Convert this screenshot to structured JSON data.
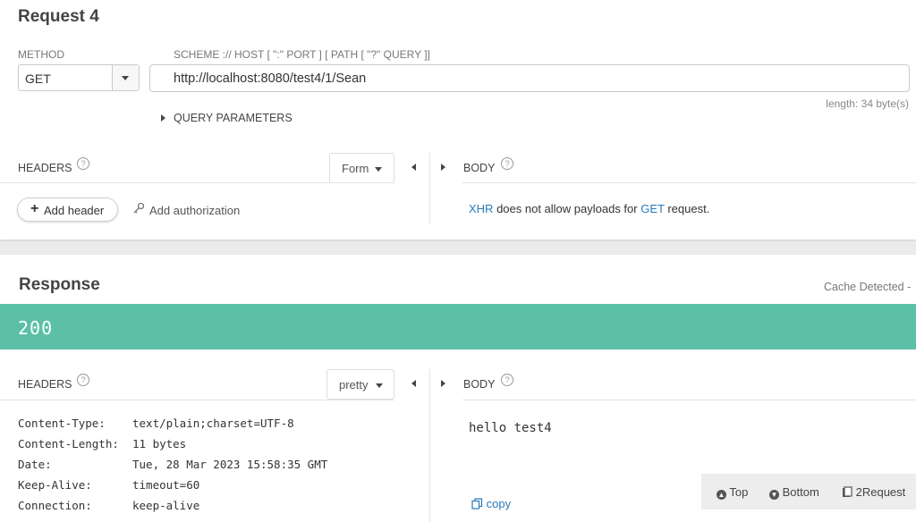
{
  "request": {
    "title": "Request 4",
    "method_label": "METHOD",
    "url_hint": "SCHEME :// HOST [ \":\" PORT ] [ PATH [ \"?\" QUERY ]]",
    "method_value": "GET",
    "url_value": "http://localhost:8080/test4/1/Sean",
    "length_text": "length: 34 byte(s)",
    "query_params_label": "QUERY PARAMETERS",
    "headers_label": "HEADERS",
    "headers_mode": "Form",
    "add_header_label": "Add header",
    "add_auth_label": "Add authorization",
    "body_label": "BODY",
    "body_msg": {
      "xhr": "XHR",
      "middle": " does not allow payloads for ",
      "method": "GET",
      "end": " request."
    }
  },
  "response": {
    "title": "Response",
    "cache_text": "Cache Detected -",
    "status_code": "200",
    "headers_label": "HEADERS",
    "headers_mode": "pretty",
    "body_label": "BODY",
    "headers": [
      {
        "name": "Content-Type:",
        "value": "text/plain;charset=UTF-8"
      },
      {
        "name": "Content-Length:",
        "value": "11 bytes"
      },
      {
        "name": "Date:",
        "value": "Tue, 28 Mar 2023 15:58:35 GMT"
      },
      {
        "name": "Keep-Alive:",
        "value": "timeout=60"
      },
      {
        "name": "Connection:",
        "value": "keep-alive"
      }
    ],
    "body_text": "hello test4",
    "copy_label": "copy"
  },
  "toolbar": {
    "top_label": "Top",
    "bottom_label": "Bottom",
    "to_request_label": "2Request"
  },
  "colors": {
    "status_bar": "#5bc0a5",
    "link": "#2a7ab8"
  }
}
